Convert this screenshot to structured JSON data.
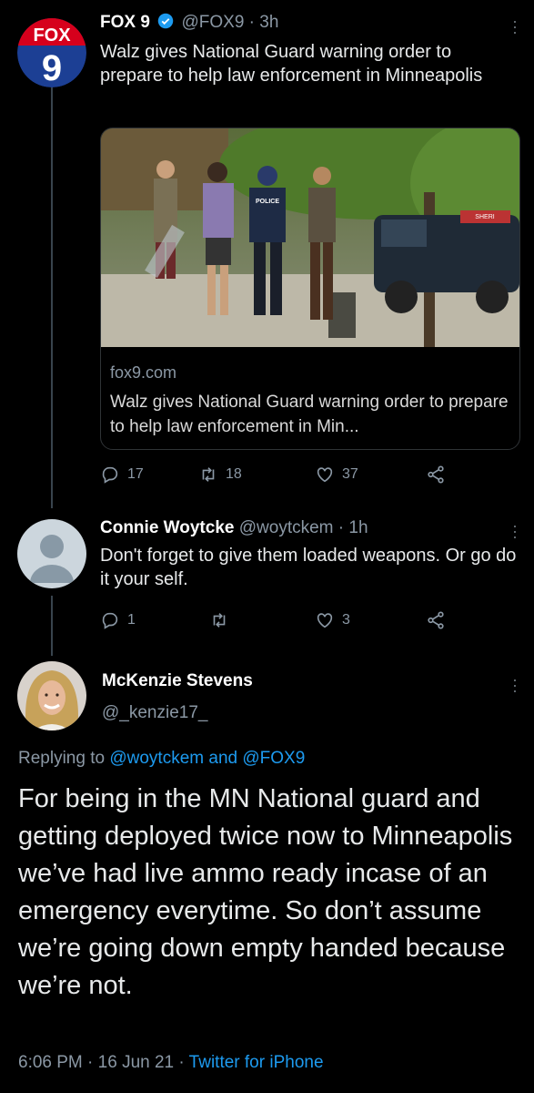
{
  "tweet1": {
    "name": "FOX 9",
    "handle": "@FOX9",
    "time": "· 3h",
    "avatar_text_top": "FOX",
    "avatar_text_bottom": "9",
    "text": "Walz gives National Guard warning order to prepare to help law enforcement in Minneapolis",
    "card": {
      "domain": "fox9.com",
      "title": "Walz gives National Guard warning order to prepare to help law enforcement in Min...",
      "police_label": "POLICE",
      "sheriff_label": "SHERI"
    },
    "actions": {
      "replies": "17",
      "retweets": "18",
      "likes": "37"
    }
  },
  "tweet2": {
    "name": "Connie Woytcke",
    "handle": "@woytckem",
    "time": "· 1h",
    "text": "Don't forget to give them loaded weapons.  Or go do it your self.",
    "actions": {
      "replies": "1",
      "retweets": "",
      "likes": "3"
    }
  },
  "tweet3": {
    "name": "McKenzie Stevens",
    "handle": "@_kenzie17_",
    "replying_prefix": "Replying to ",
    "replying_mention1": "@woytckem",
    "replying_and": " and ",
    "replying_mention2": "@FOX9",
    "text": "For being in the MN National guard and getting deployed twice now to Minneapolis we’ve had live ammo ready incase of an emergency everytime. So don’t assume we’re going down empty handed because we’re not.",
    "time": "6:06 PM",
    "date": "16 Jun 21",
    "separator": " · ",
    "source": "Twitter for iPhone"
  },
  "colors": {
    "background": "#000000",
    "accent": "#1d9bf0",
    "verified": "#1d9bf0",
    "fox_red": "#d6001c",
    "fox_blue": "#1c3f94"
  },
  "icons": [
    "reply-icon",
    "retweet-icon",
    "like-icon",
    "share-icon",
    "verified-icon",
    "more-icon"
  ]
}
